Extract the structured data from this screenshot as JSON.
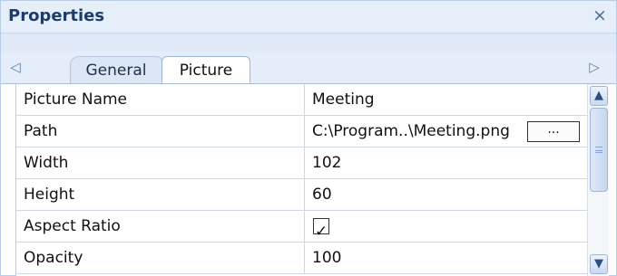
{
  "panel": {
    "title": "Properties",
    "close_glyph": "×"
  },
  "tabs": {
    "left_arrow": "◁",
    "right_arrow": "▷",
    "items": [
      {
        "label": "General",
        "active": false
      },
      {
        "label": "Picture",
        "active": true
      }
    ]
  },
  "grid": {
    "rows": [
      {
        "name": "Picture Name",
        "value": "Meeting"
      },
      {
        "name": "Path",
        "value": "C:\\Program..\\Meeting.png",
        "button_label": "..."
      },
      {
        "name": "Width",
        "value": "102"
      },
      {
        "name": "Height",
        "value": "60"
      },
      {
        "name": "Aspect Ratio",
        "value": "",
        "checked": true
      },
      {
        "name": "Opacity",
        "value": "100"
      }
    ]
  },
  "scrollbar": {
    "up_glyph": "▲",
    "down_glyph": "▼"
  },
  "colors": {
    "title_text": "#1b3d6b",
    "header_bg": "#e6eefa",
    "grid_border": "#cfd9e6"
  },
  "icons": [
    "close-icon",
    "scroll-left-icon",
    "scroll-right-icon",
    "browse-icon",
    "checkbox-icon",
    "scroll-up-icon",
    "scroll-down-icon",
    "grip-icon"
  ]
}
